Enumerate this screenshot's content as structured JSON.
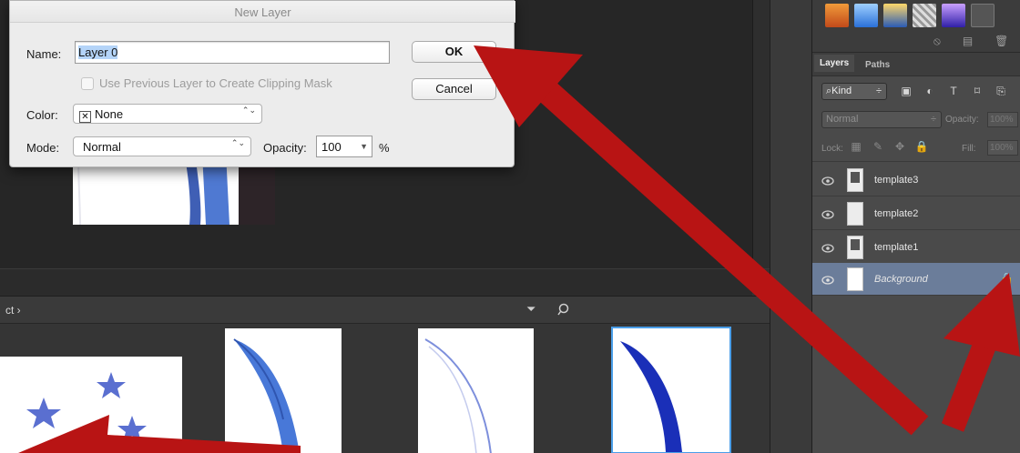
{
  "dialog": {
    "title": "New Layer",
    "name_label": "Name:",
    "name_value": "Layer 0",
    "clip_label": "Use Previous Layer to Create Clipping Mask",
    "color_label": "Color:",
    "color_value": "None",
    "color_x": "✕",
    "mode_label": "Mode:",
    "mode_value": "Normal",
    "opacity_label": "Opacity:",
    "opacity_value": "100",
    "opacity_unit": "%",
    "ok_label": "OK",
    "cancel_label": "Cancel",
    "updown_glyph": "⌃⌄",
    "drop_glyph": "▼"
  },
  "library": {
    "breadcrumb": "ct ›",
    "filter_glyph": "⏷",
    "selected_thumb_color": "#4a9ee8"
  },
  "panel": {
    "tabs": [
      "Layers",
      "Paths"
    ],
    "kind_label": "⌕Kind",
    "kind_arrow": "÷",
    "blend_mode": "Normal",
    "blend_arrow": "÷",
    "opacity_label": "Opacity:",
    "opacity_value": "100%",
    "lock_label": "Lock:",
    "fill_label": "Fill:",
    "fill_value": "100%",
    "layers": [
      {
        "name": "template3",
        "thumb": "smart"
      },
      {
        "name": "template2",
        "thumb": "transparent"
      },
      {
        "name": "template1",
        "thumb": "smart"
      },
      {
        "name": "Background",
        "thumb": "white",
        "selected": true,
        "locked": true
      }
    ],
    "selected_row_color": "#6b7d9a"
  },
  "colors": {
    "arrow": "#b81414",
    "dialog_bg": "#ececec",
    "panel_bg": "#4a4a4a"
  }
}
